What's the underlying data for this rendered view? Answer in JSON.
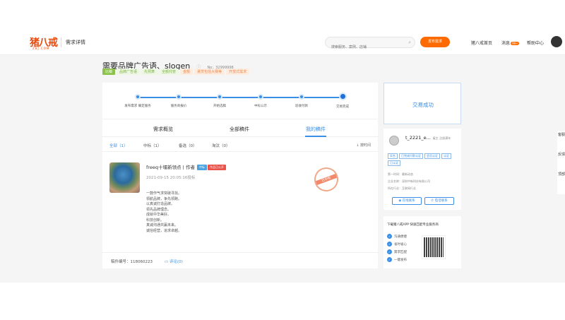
{
  "header": {
    "logo": "猪八戒",
    "logo_sub": "ZBJ.COM",
    "page_name": "需求详情",
    "search_placeholder": "搜索服务、案例、店铺",
    "publish_label": "发布需求",
    "nav_home": "猪八戒首页",
    "nav_messages": "消息",
    "messages_badge": "99+",
    "nav_help": "帮助中心"
  },
  "requirement": {
    "title": "需要品牌广告语、slogen",
    "number": "No：32999998",
    "tags": [
      "比稿",
      "品牌广告语",
      "先预算",
      "全额托管",
      "金额",
      "悬赏包括大赛等",
      "开放式需求"
    ]
  },
  "progress": {
    "steps": [
      "发布需求 确定服务",
      "服务商报价",
      "开始选稿",
      "中标公示",
      "验收付款",
      "交易完成"
    ]
  },
  "tabs": {
    "items": [
      "需求概览",
      "全部稿件",
      "我的稿件"
    ]
  },
  "filters": {
    "items": [
      "全部（1）",
      "中标（1）",
      "备选（0）",
      "淘汰（0）"
    ],
    "sort": "↓ 按时间"
  },
  "work": {
    "author": "freeq十堰新领点丨作者",
    "badge_blue": "中标",
    "badge_orange": "作品已公开",
    "date": "2021-09-15 20:05:16投标",
    "body": "一鼓作气求突破寻找。\n领航品牌，争先领跑。\n以真诚打造品牌。\n领先品牌理念。\n成就中华美好。\n科技创新。\n真诚沟通共赢未来。\n诚信经营，追求卓越。",
    "stamp": "已中标",
    "work_id": "稿件编号：118060223",
    "comment": "评论(0)"
  },
  "status": {
    "text": "交易成功"
  },
  "employer": {
    "name": "t_2221_e...",
    "sub": "雇主 注册满年",
    "tags": [
      "实名",
      "已完成付款认证",
      "会员认证",
      "认证",
      "已认证"
    ],
    "info1": "第一时间：最新动态",
    "info2": "企业名称：深圳中新科技有限公司",
    "info3": "所在行业：互联网行业",
    "contact_btn": "在线联系",
    "phone_btn": "电话联系"
  },
  "app": {
    "title": "下载猪八戒APP 快速匹配专业服务商",
    "features": [
      "沟通便捷",
      "省时省心",
      "需求匹配",
      "一键发布"
    ]
  },
  "side": {
    "items": [
      "客服",
      "反馈",
      "顶部"
    ]
  }
}
